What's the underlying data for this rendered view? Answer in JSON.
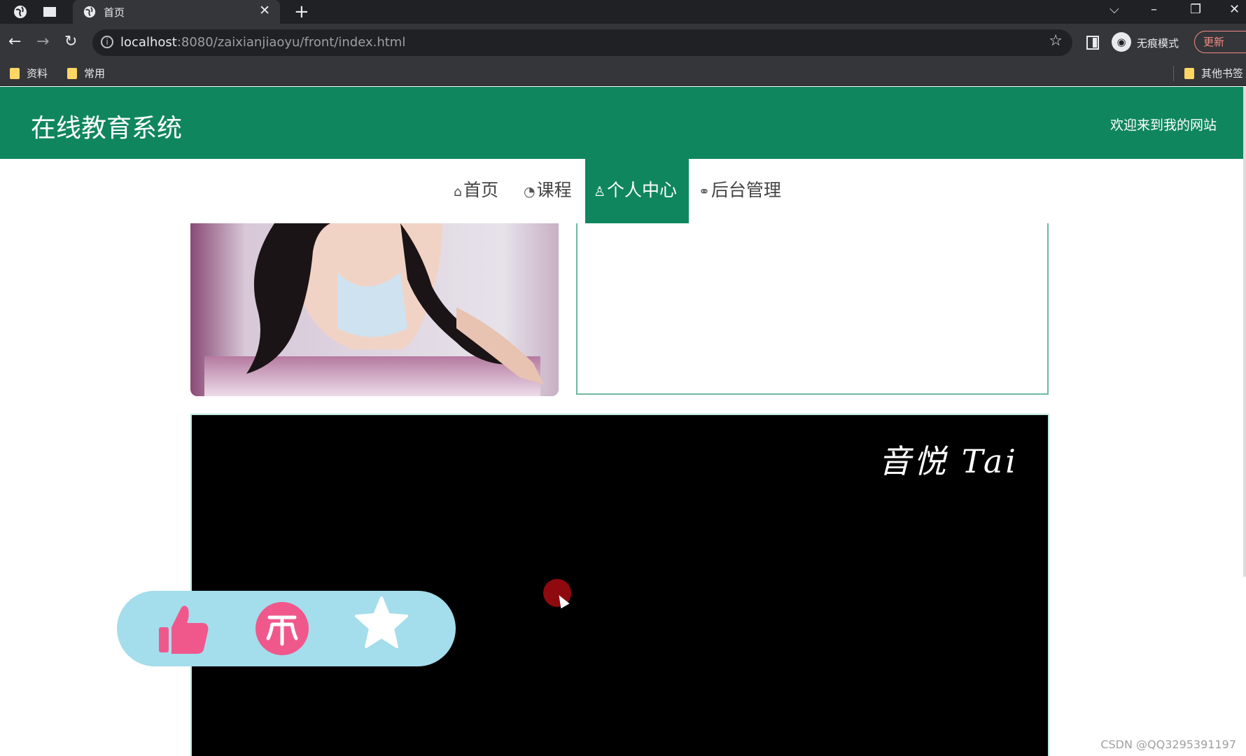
{
  "browser": {
    "tab_title": "首页",
    "url_host": "localhost",
    "url_rest": ":8080/zaixianjiaoyu/front/index.html",
    "incognito_label": "无痕模式",
    "update_label": "更新",
    "bookmarks": [
      "资料",
      "常用"
    ],
    "other_bookmarks": "其他书签",
    "icons": [
      "globe-icon",
      "tab-strip-icon",
      "close-icon",
      "new-tab-icon",
      "back-icon",
      "forward-icon",
      "reload-icon",
      "info-icon",
      "star-icon",
      "side-panel-icon",
      "incognito-icon",
      "folder-icon"
    ]
  },
  "site": {
    "title": "在线教育系统",
    "welcome": "欢迎来到我的网站"
  },
  "nav": {
    "items": [
      {
        "label": "首页",
        "icon": "home-icon"
      },
      {
        "label": "课程",
        "icon": "dashboard-icon"
      },
      {
        "label": "个人中心",
        "icon": "user-icon",
        "active": true
      },
      {
        "label": "后台管理",
        "icon": "link-icon"
      }
    ]
  },
  "video": {
    "watermark": "音悦 Tai"
  },
  "actions": {
    "icons": [
      "thumbs-up-icon",
      "coin-icon",
      "star-icon"
    ],
    "colors": {
      "bar": "#a4ddec",
      "pink": "#f0588c",
      "white": "#ffffff"
    }
  },
  "footer": {
    "credit": "CSDN @QQ3295391197"
  },
  "colors": {
    "brand": "#10865f"
  }
}
